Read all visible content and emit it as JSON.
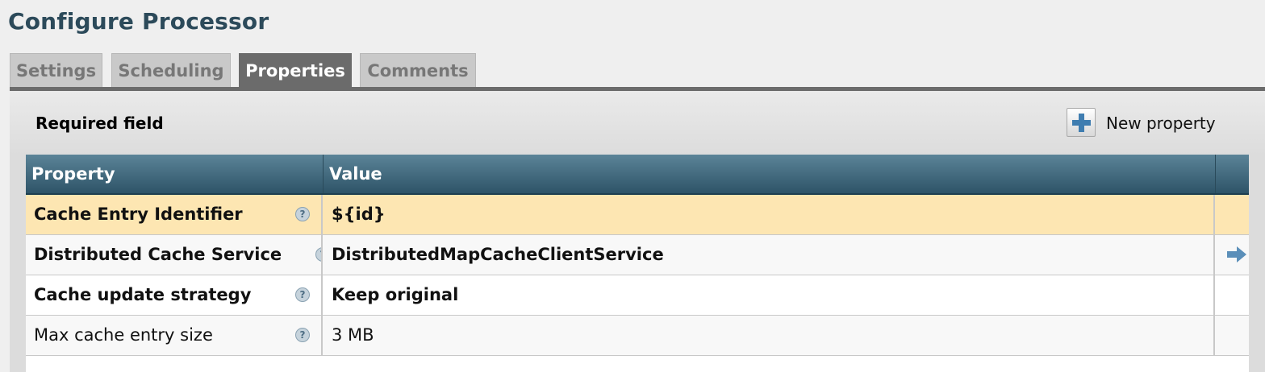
{
  "dialog": {
    "title": "Configure Processor"
  },
  "tabs": [
    {
      "label": "Settings",
      "selected": false
    },
    {
      "label": "Scheduling",
      "selected": false
    },
    {
      "label": "Properties",
      "selected": true
    },
    {
      "label": "Comments",
      "selected": false
    }
  ],
  "toolbar": {
    "required_label": "Required field",
    "new_property_label": "New property",
    "new_property_icon": "plus-icon"
  },
  "grid": {
    "columns": [
      "Property",
      "Value",
      ""
    ],
    "rows": [
      {
        "name": "Cache Entry Identifier",
        "value": "${id}",
        "required": true,
        "selected": true,
        "has_goto": false
      },
      {
        "name": "Distributed Cache Service",
        "value": "DistributedMapCacheClientService",
        "required": true,
        "selected": false,
        "has_goto": true
      },
      {
        "name": "Cache update strategy",
        "value": "Keep original",
        "required": true,
        "selected": false,
        "has_goto": false
      },
      {
        "name": "Max cache entry size",
        "value": "3 MB",
        "required": false,
        "selected": false,
        "has_goto": false
      }
    ],
    "help_icon": "?",
    "goto_icon": "arrow-right-icon"
  },
  "colors": {
    "title": "#2c4a5a",
    "selected_tab": "#6b6b6b",
    "header_top": "#5b8498",
    "header_bottom": "#2e5468",
    "selected_row": "#fde6b2",
    "plus": "#3f7db0"
  }
}
